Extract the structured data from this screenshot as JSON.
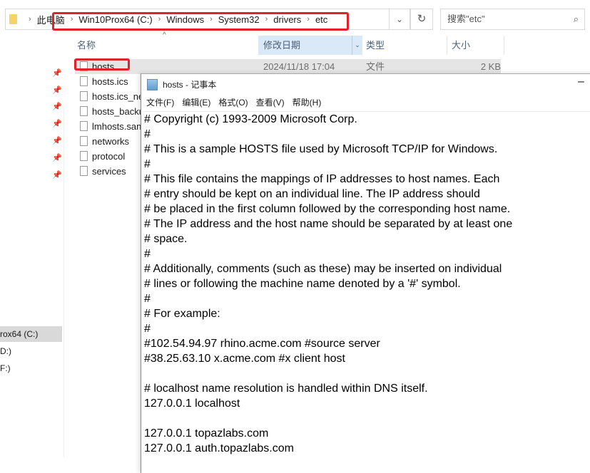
{
  "explorer": {
    "breadcrumb": [
      "此电脑",
      "Win10Prox64 (C:)",
      "Windows",
      "System32",
      "drivers",
      "etc"
    ],
    "search_placeholder": "搜索\"etc\"",
    "columns": {
      "name": "名称",
      "date": "修改日期",
      "type": "类型",
      "size": "大小"
    },
    "files": [
      {
        "name": "hosts",
        "date": "2024/11/18 17:04",
        "type": "文件",
        "size": "2 KB"
      },
      {
        "name": "hosts.ics"
      },
      {
        "name": "hosts.ics_ne"
      },
      {
        "name": "hosts_backu"
      },
      {
        "name": "lmhosts.san"
      },
      {
        "name": "networks"
      },
      {
        "name": "protocol"
      },
      {
        "name": "services"
      }
    ],
    "drives": [
      "rox64 (C:)",
      "D:)",
      "F:)"
    ]
  },
  "notepad": {
    "title": "hosts - 记事本",
    "menu": [
      "文件(F)",
      "编辑(E)",
      "格式(O)",
      "查看(V)",
      "帮助(H)"
    ],
    "lines": [
      "# Copyright (c) 1993-2009 Microsoft Corp.",
      "#",
      "# This is a sample HOSTS file used by Microsoft TCP/IP for Windows.",
      "#",
      "# This file contains the mappings of IP addresses to host names. Each",
      "# entry should be kept on an individual line. The IP address should",
      "# be placed in the first column followed by the corresponding host name.",
      "# The IP address and the host name should be separated by at least one",
      "# space.",
      "#",
      "# Additionally, comments (such as these) may be inserted on individual",
      "# lines or following the machine name denoted by a '#' symbol.",
      "#",
      "# For example:",
      "#",
      "#102.54.94.97 rhino.acme.com #source server",
      "#38.25.63.10 x.acme.com #x client host",
      "",
      "# localhost name resolution is handled within DNS itself.",
      "127.0.0.1 localhost",
      "",
      "127.0.0.1 topazlabs.com",
      "127.0.0.1 auth.topazlabs.com"
    ]
  },
  "colors": {
    "highlight": "#e0232b",
    "selected_header": "#d9e9f7"
  }
}
